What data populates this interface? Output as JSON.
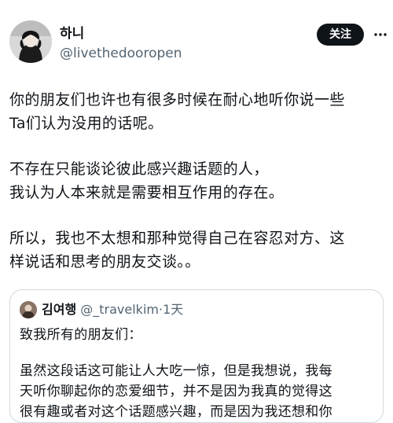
{
  "author": {
    "name": "하니",
    "handle": "@livethedooropen"
  },
  "follow_label": "关注",
  "tweet": {
    "lines": [
      "你的朋友们也许也有很多时候在耐心地听你说一些",
      "Ta们认为没用的话呢。",
      "不存在只能谈论彼此感兴趣话题的人，",
      "我认为人本来就是需要相互作用的存在。",
      "所以，我也不太想和那种觉得自己在容忍对方、这",
      "样说话和思考的朋友交谈。。"
    ]
  },
  "quote": {
    "name": "김여행",
    "handle": "@_travelkim",
    "dot": "·",
    "time": "1天",
    "lines": [
      "致我所有的朋友们：",
      "虽然这段话这可能让人大吃一惊，但是我想说，我每",
      "天听你聊起你的恋爱细节，并不是因为我真的觉得这",
      "很有趣或者对这个话题感兴趣，而是因为我还想和你"
    ]
  }
}
